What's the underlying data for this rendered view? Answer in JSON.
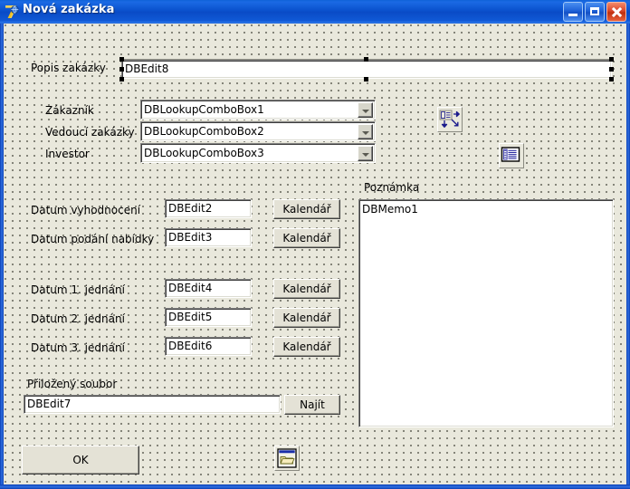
{
  "window": {
    "title": "Nová zakázka",
    "icon": "delphi7-logo-icon",
    "buttons": {
      "minimize": "minimize-button",
      "maximize": "maximize-button",
      "close": "close-button"
    }
  },
  "form": {
    "description": {
      "label": "Popis zakázky",
      "field_value": "DBEdit8",
      "selected": true
    },
    "lookups": [
      {
        "label": "Zákazník",
        "value": "DBLookupComboBox1"
      },
      {
        "label": "Vedoucí zakázky",
        "value": "DBLookupComboBox2"
      },
      {
        "label": "Investor",
        "value": "DBLookupComboBox3"
      }
    ],
    "dates_group_a": [
      {
        "label": "Datum vyhodnocení",
        "value": "DBEdit2",
        "button": "Kalendář"
      },
      {
        "label": "Datum podání nabídky",
        "value": "DBEdit3",
        "button": "Kalendář"
      }
    ],
    "dates_group_b": [
      {
        "label": "Datum 1. jednání",
        "value": "DBEdit4",
        "button": "Kalendář"
      },
      {
        "label": "Datum 2. jednání",
        "value": "DBEdit5",
        "button": "Kalendář"
      },
      {
        "label": "Datum 3. jednání",
        "value": "DBEdit6",
        "button": "Kalendář"
      }
    ],
    "attachment": {
      "label": "Přiložený soubor",
      "field_value": "DBEdit7",
      "browse_button": "Najít"
    },
    "note": {
      "label": "Poznámka",
      "memo_value": "DBMemo1"
    },
    "ok_button": "OK",
    "nonvisual": [
      {
        "name": "datasource-component-icon"
      },
      {
        "name": "dataset-table-component-icon"
      },
      {
        "name": "opendialog-component-icon"
      }
    ]
  },
  "colors": {
    "titlebar_blue": "#0a4bc6",
    "close_red": "#d9462a",
    "form_surface": "#e9e8dc",
    "button_face": "#e4e2d6",
    "field_white": "#ffffff",
    "grid_dot": "#6b6b60"
  }
}
